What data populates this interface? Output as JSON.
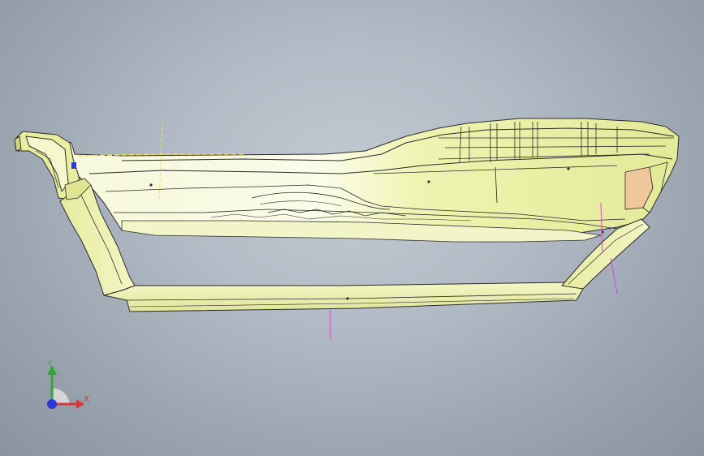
{
  "viewport": {
    "background_color": "#b3bcc6",
    "part_color": "#eef3b4",
    "part_shade_color": "#d6dd8a",
    "edge_color": "#2b2b2b",
    "datum_line_color": "#e23ce0",
    "tan_patch_color": "#efc79a",
    "highlight_yellow": "#f2e23a"
  },
  "triad": {
    "x_label": "X",
    "y_label": "Y",
    "x_color": "#d23a3a",
    "y_color": "#3aa23a",
    "z_color": "#2a39d8"
  }
}
